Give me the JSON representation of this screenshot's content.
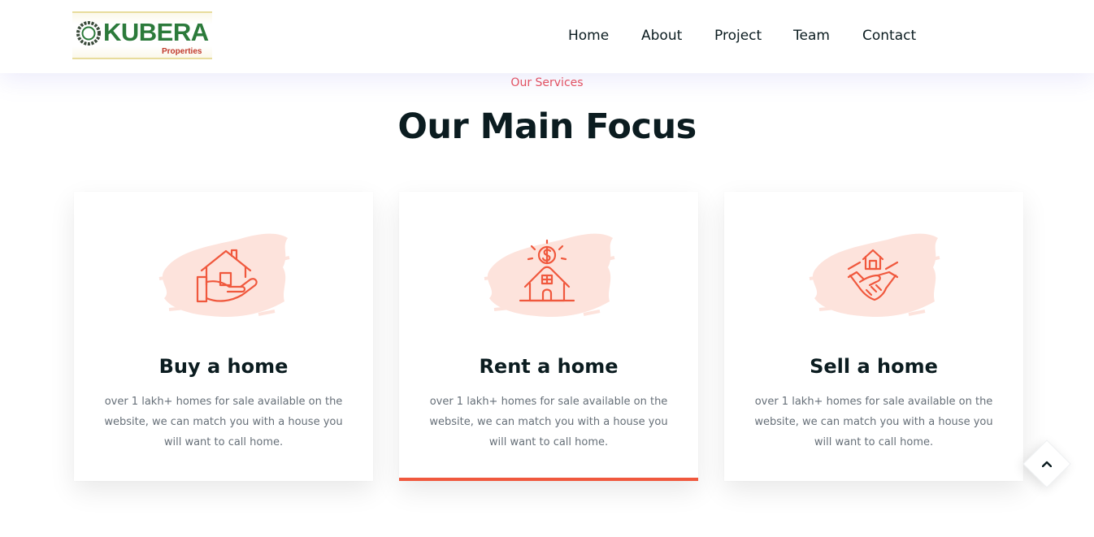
{
  "header": {
    "logo": {
      "name": "KUBERA",
      "sub": "Properties"
    },
    "nav": [
      {
        "label": "Home"
      },
      {
        "label": "About"
      },
      {
        "label": "Project"
      },
      {
        "label": "Team"
      },
      {
        "label": "Contact"
      }
    ]
  },
  "section": {
    "eyebrow": "Our Services",
    "title": "Our Main Focus"
  },
  "cards": [
    {
      "icon": "house-in-hand-icon",
      "title": "Buy a home",
      "description": "over 1 lakh+ homes for sale available on the website, we can match you with a house you will want to call home.",
      "active": false
    },
    {
      "icon": "house-dollar-icon",
      "title": "Rent a home",
      "description": "over 1 lakh+ homes for sale available on the website, we can match you with a house you will want to call home.",
      "active": true
    },
    {
      "icon": "house-handshake-icon",
      "title": "Sell a home",
      "description": "over 1 lakh+ homes for sale available on the website, we can match you with a house you will want to call home.",
      "active": false
    }
  ],
  "scroll_top": {
    "icon": "chevron-up-icon"
  },
  "colors": {
    "accent": "#f0583d",
    "eyebrow": "#e8505b",
    "heading": "#0b1c20",
    "body_text": "#666f78",
    "icon_blob": "#fde3dc",
    "logo_green": "#2b7a3a",
    "logo_red": "#c0392b"
  }
}
